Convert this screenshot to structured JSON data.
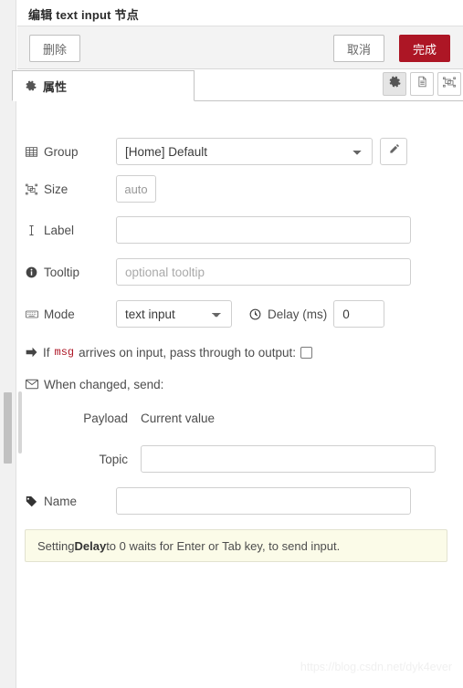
{
  "dialog": {
    "title": "编辑 text input 节点"
  },
  "toolbar": {
    "delete_label": "删除",
    "cancel_label": "取消",
    "done_label": "完成",
    "done_color": "#ad1625"
  },
  "tabs": {
    "active": "属性",
    "items": [
      {
        "label": "属性",
        "icon": "gear-icon"
      }
    ],
    "actions": [
      {
        "name": "properties-tab-icon",
        "icon": "gear-icon",
        "active": true
      },
      {
        "name": "description-tab-icon",
        "icon": "document-icon",
        "active": false
      },
      {
        "name": "appearance-tab-icon",
        "icon": "object-group-icon",
        "active": false
      }
    ]
  },
  "form": {
    "group": {
      "label": "Group",
      "icon": "table-icon",
      "value": "[Home] Default",
      "options": [
        "[Home] Default"
      ],
      "edit_button_icon": "pencil-icon"
    },
    "size": {
      "label": "Size",
      "icon": "object-group-icon",
      "value": "auto"
    },
    "label_field": {
      "label": "Label",
      "icon": "text-cursor-icon",
      "value": "",
      "placeholder": ""
    },
    "tooltip": {
      "label": "Tooltip",
      "icon": "info-circle-icon",
      "value": "",
      "placeholder": "optional tooltip"
    },
    "mode": {
      "label": "Mode",
      "icon": "keyboard-icon",
      "value": "text input",
      "options": [
        "text input"
      ]
    },
    "delay": {
      "label": "Delay (ms)",
      "icon": "clock-icon",
      "value": "0"
    },
    "passthrough": {
      "icon": "arrow-right-icon",
      "text_before": "If",
      "msg_token": "msg",
      "text_after": "arrives on input, pass through to output:",
      "checked": false
    },
    "when_changed": {
      "icon": "envelope-icon",
      "label": "When changed, send:"
    },
    "payload": {
      "label": "Payload",
      "value": "Current value"
    },
    "topic": {
      "label": "Topic",
      "value": "",
      "placeholder": ""
    },
    "name": {
      "label": "Name",
      "icon": "tag-icon",
      "value": "",
      "placeholder": ""
    },
    "note": {
      "prefix": "Setting ",
      "bold": "Delay",
      "suffix": " to 0 waits for Enter or Tab key, to send input."
    }
  },
  "watermark": {
    "text": "https://blog.csdn.net/dyk4ever"
  }
}
